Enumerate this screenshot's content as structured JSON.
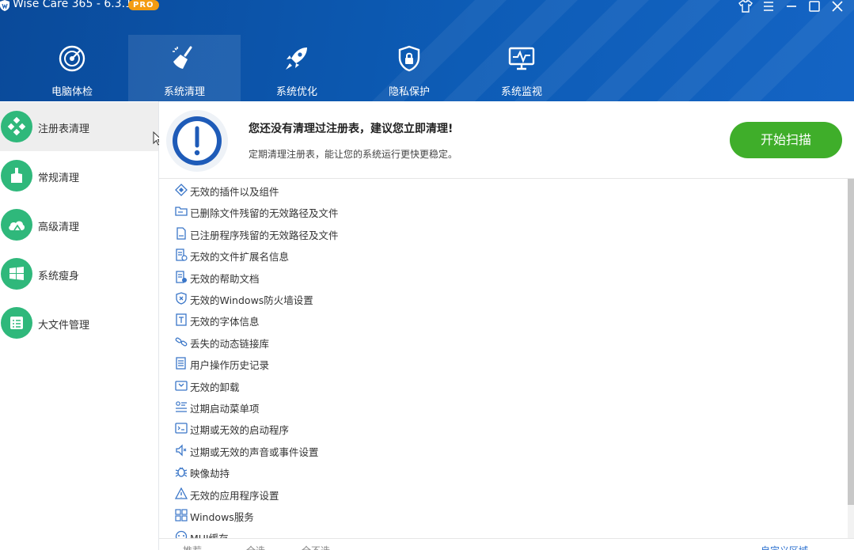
{
  "app": {
    "title": "Wise Care 365 - 6.3.1",
    "badge": "PRO",
    "window_controls": [
      "skin-icon",
      "menu-icon",
      "minimize-icon",
      "maximize-icon",
      "close-icon"
    ]
  },
  "nav": {
    "active": "tab-system-clean",
    "tabs": [
      {
        "label": "电脑体检",
        "icon": "radar-icon"
      },
      {
        "label": "系统清理",
        "icon": "broom-icon"
      },
      {
        "label": "系统优化",
        "icon": "rocket-icon"
      },
      {
        "label": "隐私保护",
        "icon": "shield-lock-icon"
      },
      {
        "label": "系统监视",
        "icon": "monitor-icon"
      }
    ]
  },
  "sidebar": {
    "items": [
      {
        "label": "注册表清理",
        "icon": "registry-icon",
        "active": true
      },
      {
        "label": "常规清理",
        "icon": "brush-icon"
      },
      {
        "label": "高级清理",
        "icon": "cloud-icon"
      },
      {
        "label": "系统瘦身",
        "icon": "windows-icon"
      },
      {
        "label": "大文件管理",
        "icon": "file-list-icon"
      }
    ]
  },
  "banner": {
    "title": "您还没有清理过注册表，建议您立即清理!",
    "subtitle": "定期清理注册表，能让您的系统运行更快更稳定。",
    "scan_button": "开始扫描",
    "colors": {
      "accent": "#1e5bb8",
      "button": "#3fae2a"
    }
  },
  "list": {
    "items": [
      {
        "label": "无效的插件以及组件",
        "icon": "puzzle-icon"
      },
      {
        "label": "已删除文件残留的无效路径及文件",
        "icon": "folder-icon"
      },
      {
        "label": "已注册程序残留的无效路径及文件",
        "icon": "file-icon"
      },
      {
        "label": "无效的文件扩展名信息",
        "icon": "doc-ext-icon"
      },
      {
        "label": "无效的帮助文档",
        "icon": "help-doc-icon"
      },
      {
        "label": "无效的Windows防火墙设置",
        "icon": "firewall-icon"
      },
      {
        "label": "无效的字体信息",
        "icon": "font-icon"
      },
      {
        "label": "丢失的动态链接库",
        "icon": "link-icon"
      },
      {
        "label": "用户操作历史记录",
        "icon": "history-icon"
      },
      {
        "label": "无效的卸载",
        "icon": "uninstall-icon"
      },
      {
        "label": "过期启动菜单项",
        "icon": "start-menu-icon"
      },
      {
        "label": "过期或无效的启动程序",
        "icon": "startup-icon"
      },
      {
        "label": "过期或无效的声音或事件设置",
        "icon": "sound-icon"
      },
      {
        "label": "映像劫持",
        "icon": "bug-icon"
      },
      {
        "label": "无效的应用程序设置",
        "icon": "warning-icon"
      },
      {
        "label": "Windows服务",
        "icon": "services-icon"
      },
      {
        "label": "MUI缓存",
        "icon": "cache-icon"
      }
    ]
  },
  "footer": {
    "options": [
      "推荐",
      "全选",
      "全不选"
    ],
    "custom": "自定义区域"
  }
}
